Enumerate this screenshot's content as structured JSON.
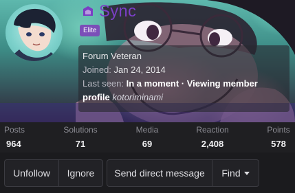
{
  "profile": {
    "username": "Sync",
    "badge": "Elite",
    "user_title": "Forum Veteran",
    "joined_label": "Joined:",
    "joined_date": "Jan 24, 2014",
    "last_seen_label": "Last seen:",
    "last_seen_value": "In a moment · Viewing member profile",
    "last_seen_target": "kotoriminami"
  },
  "stats": [
    {
      "label": "Posts",
      "value": "964"
    },
    {
      "label": "Solutions",
      "value": "71"
    },
    {
      "label": "Media",
      "value": "69"
    },
    {
      "label": "Reaction",
      "value": "2,408"
    },
    {
      "label": "Points",
      "value": "578"
    }
  ],
  "actions": {
    "unfollow": "Unfollow",
    "ignore": "Ignore",
    "message": "Send direct message",
    "find": "Find"
  },
  "colors": {
    "username": "#7a3fc4",
    "badge_bg": "#7b4fb8",
    "background": "#1b1b1e"
  },
  "icons": {
    "username_icon": "sync-icon",
    "find_caret": "chevron-down-icon"
  }
}
